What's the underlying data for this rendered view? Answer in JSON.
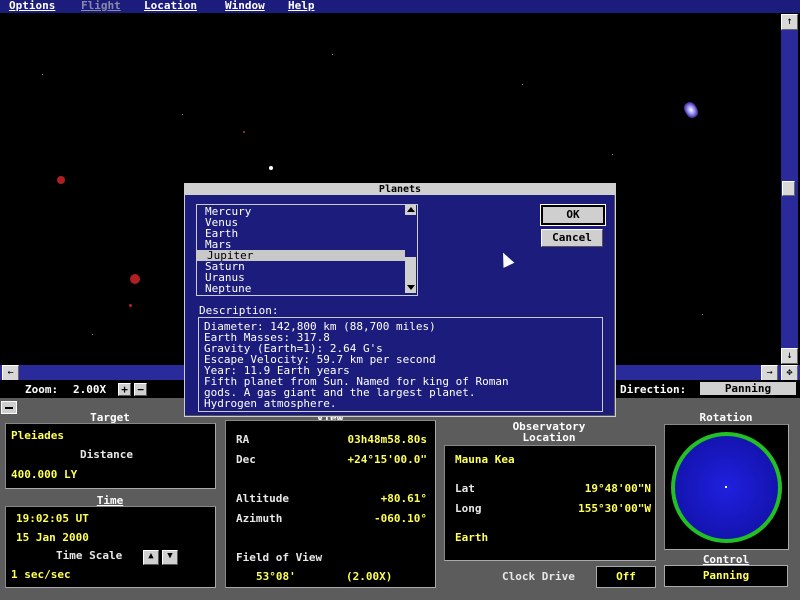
{
  "menu": {
    "items": [
      {
        "label": "Options",
        "disabled": false
      },
      {
        "label": "Flight",
        "disabled": true
      },
      {
        "label": "Location",
        "disabled": false
      },
      {
        "label": "Window",
        "disabled": false
      },
      {
        "label": "Help",
        "disabled": false
      }
    ]
  },
  "scroll": {
    "up": "↑",
    "down": "↓",
    "left": "←",
    "right": "→",
    "corner": "✥"
  },
  "zoombar": {
    "zoom_label": "Zoom:",
    "zoom_value": "2.00X",
    "plus": "+",
    "minus": "−",
    "direction_label": "Direction:",
    "direction_value": "Panning"
  },
  "dialog": {
    "title": "Planets",
    "planets": [
      "Mercury",
      "Venus",
      "Earth",
      "Mars",
      "Jupiter",
      "Saturn",
      "Uranus",
      "Neptune"
    ],
    "selected": "Jupiter",
    "ok_label": "OK",
    "cancel_label": "Cancel",
    "description_label": "Description:",
    "description_lines": [
      "Diameter: 142,800 km (88,700 miles)",
      "Earth Masses: 317.8",
      "Gravity (Earth=1): 2.64 G's",
      "Escape Velocity: 59.7 km per second",
      "Year: 11.9 Earth years",
      "Fifth planet from Sun. Named for king of Roman",
      "gods. A gas giant and the largest planet.",
      "Hydrogen atmosphere."
    ]
  },
  "target": {
    "title": "Target",
    "name": "Pleiades",
    "distance_label": "Distance",
    "distance_value": "400.000 LY"
  },
  "time": {
    "title": "Time",
    "clock": "19:02:05 UT",
    "date": "15 Jan 2000",
    "scale_label": "Time Scale",
    "scale_value": "1 sec/sec",
    "up": "▲",
    "down": "▼"
  },
  "view": {
    "title": "View",
    "ra_label": "RA",
    "ra_value": "03h48m58.80s",
    "dec_label": "Dec",
    "dec_value": "+24°15'00.0\"",
    "alt_label": "Altitude",
    "alt_value": "+80.61°",
    "az_label": "Azimuth",
    "az_value": "-060.10°",
    "fov_label": "Field of View",
    "fov_value": "53°08'",
    "fov_zoom": "(2.00X)"
  },
  "observatory": {
    "title_line1": "Observatory",
    "title_line2": "Location",
    "site": "Mauna Kea",
    "lat_label": "Lat",
    "lat_value": "19°48'00\"N",
    "long_label": "Long",
    "long_value": "155°30'00\"W",
    "planet": "Earth"
  },
  "clock_drive": {
    "label": "Clock Drive",
    "value": "Off"
  },
  "rotation": {
    "title": "Rotation"
  },
  "control": {
    "title": "Control",
    "value": "Panning"
  },
  "colors": {
    "menu_bg": "#1c1c7c",
    "panel_bg": "#5c5c5c",
    "accent_yellow": "#ffff55",
    "globe_ring": "#22c022",
    "globe_fill": "#1a1ad8"
  }
}
